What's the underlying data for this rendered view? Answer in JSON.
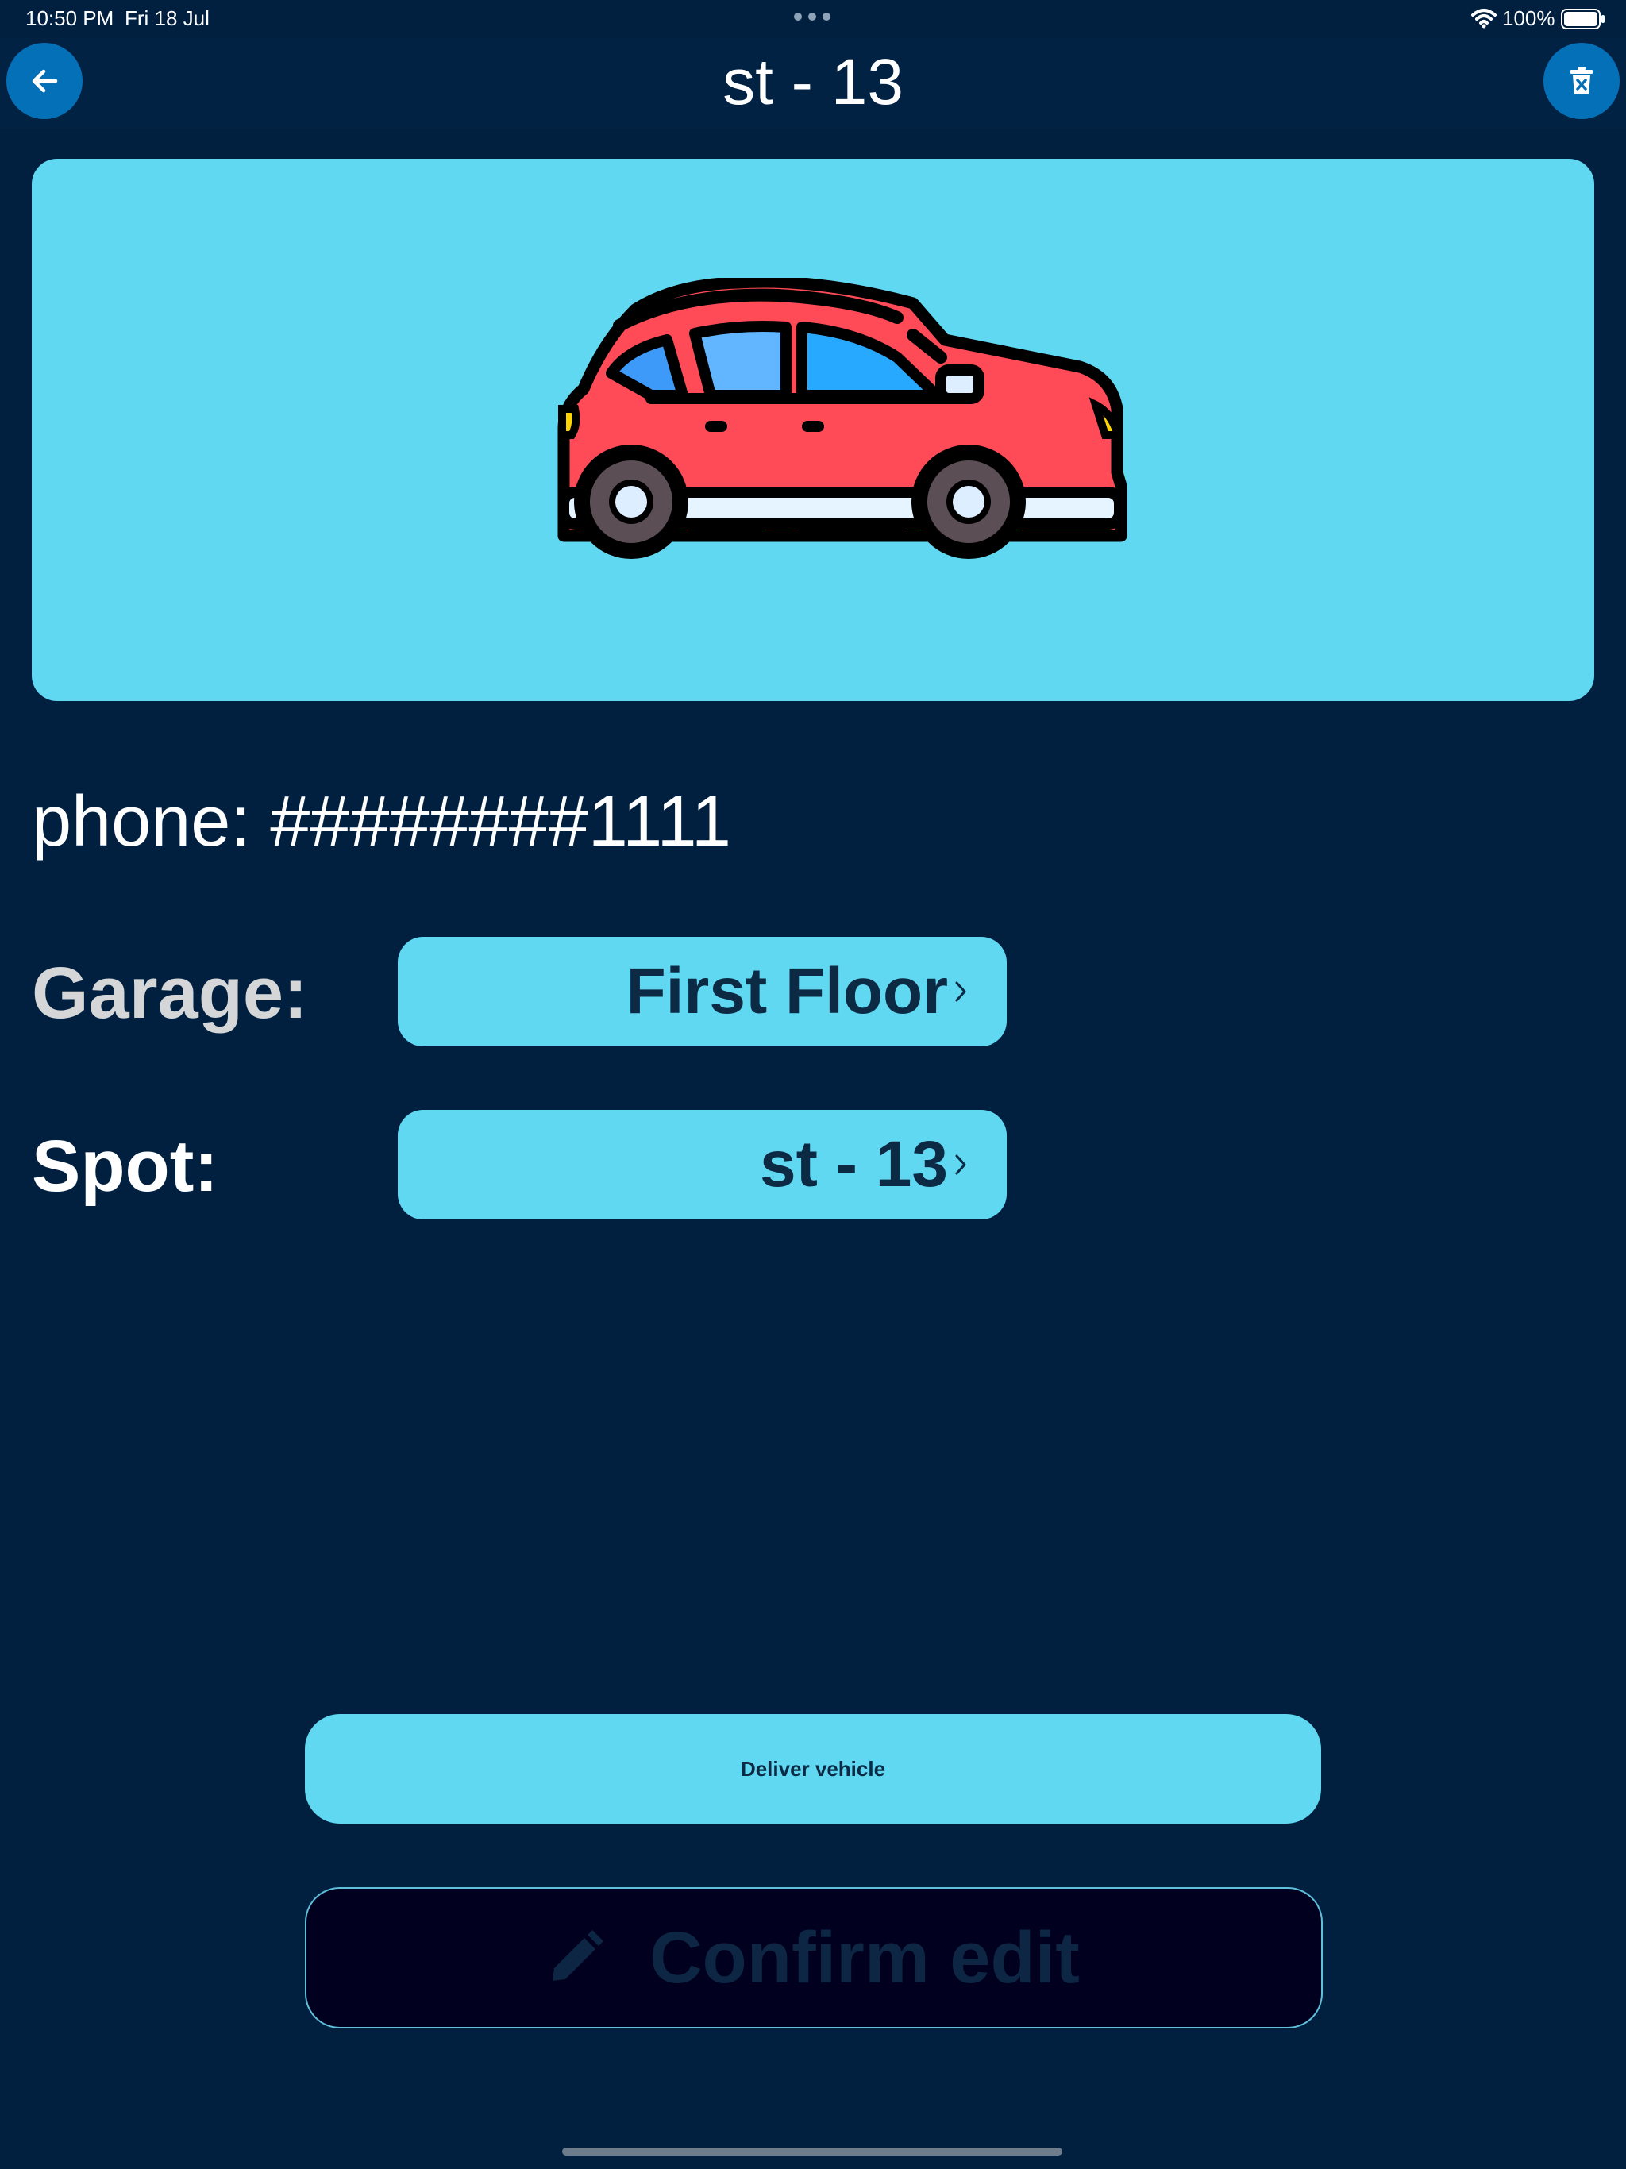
{
  "status_bar": {
    "time": "10:50 PM",
    "date": "Fri 18 Jul",
    "battery": "100%"
  },
  "header": {
    "title": "st - 13",
    "back_icon": "arrow-left-icon",
    "delete_icon": "trash-x-icon"
  },
  "vehicle": {
    "image": "red-car-icon",
    "phone": "phone: ########1111"
  },
  "fields": {
    "garage_label": "Garage:",
    "garage_value": "First Floor",
    "spot_label": "Spot:",
    "spot_value": "st - 13"
  },
  "actions": {
    "deliver_label": "Deliver vehicle",
    "confirm_label": "Confirm edit",
    "confirm_icon": "pencil-icon"
  },
  "colors": {
    "background": "#012040",
    "accent": "#61d8f2",
    "button_blue": "#0470b8",
    "dark_text": "#0c2a44"
  }
}
